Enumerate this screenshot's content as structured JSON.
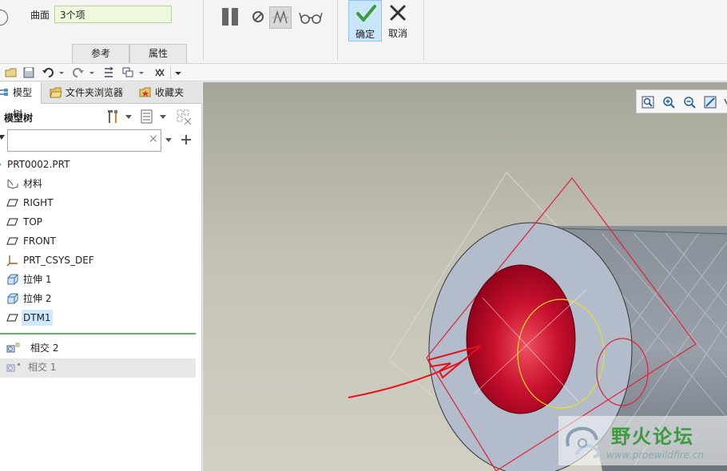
{
  "ribbon": {
    "surface_label": "曲面",
    "surface_value": "3个项",
    "tabs": [
      "参考",
      "属性"
    ],
    "ok_label": "确定",
    "cancel_label": "取消",
    "icons": [
      "pause-icon",
      "stop-icon",
      "verify-icon",
      "glasses-icon",
      "checkmark-icon",
      "cancel-x-icon"
    ]
  },
  "panel_tabs": [
    {
      "label": "模型树",
      "icon": "model-tree-icon"
    },
    {
      "label": "文件夹浏览器",
      "icon": "folder-browser-icon"
    },
    {
      "label": "收藏夹",
      "icon": "favorites-icon"
    }
  ],
  "tree": {
    "title": "模型树",
    "search_value": "",
    "items": [
      {
        "label": "PRT0002.PRT",
        "icon": "part-icon"
      },
      {
        "label": "材料",
        "icon": "material-icon"
      },
      {
        "label": "RIGHT",
        "icon": "datum-plane-icon"
      },
      {
        "label": "TOP",
        "icon": "datum-plane-icon"
      },
      {
        "label": "FRONT",
        "icon": "datum-plane-icon"
      },
      {
        "label": "PRT_CSYS_DEF",
        "icon": "csys-icon"
      },
      {
        "label": "拉伸 1",
        "icon": "extrude-icon"
      },
      {
        "label": "拉伸 2",
        "icon": "extrude-icon"
      },
      {
        "label": "DTM1",
        "icon": "datum-plane-icon",
        "selected": true
      },
      {
        "label": "相交 2",
        "icon": "intersect-icon"
      },
      {
        "label": "相交 1",
        "icon": "intersect-icon",
        "greyed": true
      }
    ]
  },
  "watermark": {
    "title": "野火论坛",
    "url": "www.proewildfire.cn"
  },
  "colors": {
    "selection": "#cde8ff",
    "accent_green": "#3d9a3d",
    "ok_button": "#c9e6f8",
    "highlight_red": "#cc0022"
  }
}
